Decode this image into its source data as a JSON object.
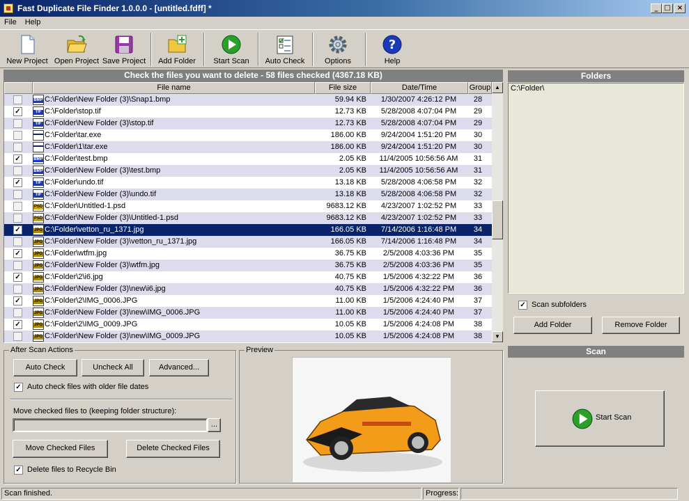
{
  "window": {
    "title": "Fast Duplicate File Finder 1.0.0.0 - [untitled.fdff] *",
    "buttons": {
      "minimize": "_",
      "maximize": "□",
      "close": "×"
    }
  },
  "menu": {
    "items": [
      "File",
      "Help"
    ]
  },
  "toolbar": {
    "new_project": "New Project",
    "open_project": "Open Project",
    "save_project": "Save Project",
    "add_folder": "Add Folder",
    "start_scan": "Start Scan",
    "auto_check": "Auto Check",
    "options": "Options",
    "help": "Help"
  },
  "files_panel": {
    "header": "Check the files you want to delete - 58 files checked (4367.18 KB)",
    "columns": {
      "name": "File name",
      "size": "File size",
      "date": "Date/Time",
      "group": "Group"
    }
  },
  "files": [
    {
      "checked": false,
      "type": "BMP",
      "name": "C:\\Folder\\New Folder (3)\\Snap1.bmp",
      "size": "59.94 KB",
      "date": "1/30/2007 4:26:12 PM",
      "group": "28"
    },
    {
      "checked": true,
      "type": "TIF",
      "name": "C:\\Folder\\stop.tif",
      "size": "12.73 KB",
      "date": "5/28/2008 4:07:04 PM",
      "group": "29"
    },
    {
      "checked": false,
      "type": "TIF",
      "name": "C:\\Folder\\New Folder (3)\\stop.tif",
      "size": "12.73 KB",
      "date": "5/28/2008 4:07:04 PM",
      "group": "29"
    },
    {
      "checked": false,
      "type": "EXE",
      "name": "C:\\Folder\\tar.exe",
      "size": "186.00 KB",
      "date": "9/24/2004 1:51:20 PM",
      "group": "30"
    },
    {
      "checked": false,
      "type": "EXE",
      "name": "C:\\Folder\\1\\tar.exe",
      "size": "186.00 KB",
      "date": "9/24/2004 1:51:20 PM",
      "group": "30"
    },
    {
      "checked": true,
      "type": "BMP",
      "name": "C:\\Folder\\test.bmp",
      "size": "2.05 KB",
      "date": "11/4/2005 10:56:56 AM",
      "group": "31"
    },
    {
      "checked": false,
      "type": "BMP",
      "name": "C:\\Folder\\New Folder (3)\\test.bmp",
      "size": "2.05 KB",
      "date": "11/4/2005 10:56:56 AM",
      "group": "31"
    },
    {
      "checked": true,
      "type": "TIF",
      "name": "C:\\Folder\\undo.tif",
      "size": "13.18 KB",
      "date": "5/28/2008 4:06:58 PM",
      "group": "32"
    },
    {
      "checked": false,
      "type": "TIF",
      "name": "C:\\Folder\\New Folder (3)\\undo.tif",
      "size": "13.18 KB",
      "date": "5/28/2008 4:06:58 PM",
      "group": "32"
    },
    {
      "checked": false,
      "type": "PSD",
      "name": "C:\\Folder\\Untitled-1.psd",
      "size": "9683.12 KB",
      "date": "4/23/2007 1:02:52 PM",
      "group": "33"
    },
    {
      "checked": false,
      "type": "PSD",
      "name": "C:\\Folder\\New Folder (3)\\Untitled-1.psd",
      "size": "9683.12 KB",
      "date": "4/23/2007 1:02:52 PM",
      "group": "33"
    },
    {
      "checked": true,
      "type": "JPG",
      "name": "C:\\Folder\\vetton_ru_1371.jpg",
      "size": "166.05 KB",
      "date": "7/14/2006 1:16:48 PM",
      "group": "34",
      "selected": true
    },
    {
      "checked": false,
      "type": "JPG",
      "name": "C:\\Folder\\New Folder (3)\\vetton_ru_1371.jpg",
      "size": "166.05 KB",
      "date": "7/14/2006 1:16:48 PM",
      "group": "34"
    },
    {
      "checked": true,
      "type": "JPG",
      "name": "C:\\Folder\\wtfm.jpg",
      "size": "36.75 KB",
      "date": "2/5/2008 4:03:36 PM",
      "group": "35"
    },
    {
      "checked": false,
      "type": "JPG",
      "name": "C:\\Folder\\New Folder (3)\\wtfm.jpg",
      "size": "36.75 KB",
      "date": "2/5/2008 4:03:36 PM",
      "group": "35"
    },
    {
      "checked": true,
      "type": "JPG",
      "name": "C:\\Folder\\2\\i6.jpg",
      "size": "40.75 KB",
      "date": "1/5/2006 4:32:22 PM",
      "group": "36"
    },
    {
      "checked": false,
      "type": "JPG",
      "name": "C:\\Folder\\New Folder (3)\\new\\i6.jpg",
      "size": "40.75 KB",
      "date": "1/5/2006 4:32:22 PM",
      "group": "36"
    },
    {
      "checked": true,
      "type": "JPG",
      "name": "C:\\Folder\\2\\IMG_0006.JPG",
      "size": "11.00 KB",
      "date": "1/5/2006 4:24:40 PM",
      "group": "37"
    },
    {
      "checked": false,
      "type": "JPG",
      "name": "C:\\Folder\\New Folder (3)\\new\\IMG_0006.JPG",
      "size": "11.00 KB",
      "date": "1/5/2006 4:24:40 PM",
      "group": "37"
    },
    {
      "checked": true,
      "type": "JPG",
      "name": "C:\\Folder\\2\\IMG_0009.JPG",
      "size": "10.05 KB",
      "date": "1/5/2006 4:24:08 PM",
      "group": "38"
    },
    {
      "checked": false,
      "type": "JPG",
      "name": "C:\\Folder\\New Folder (3)\\new\\IMG_0009.JPG",
      "size": "10.05 KB",
      "date": "1/5/2006 4:24:08 PM",
      "group": "38"
    }
  ],
  "folders_panel": {
    "header": "Folders",
    "items": [
      "C:\\Folder\\"
    ],
    "scan_subfolders": "Scan subfolders",
    "add_folder": "Add Folder",
    "remove_folder": "Remove Folder"
  },
  "after_scan": {
    "label": "After Scan Actions",
    "auto_check": "Auto Check",
    "uncheck_all": "Uncheck All",
    "advanced": "Advanced...",
    "auto_check_older": "Auto check files with older file dates",
    "move_label": "Move checked files to (keeping folder structure):",
    "move_path": "",
    "browse": "...",
    "move_button": "Move Checked Files",
    "delete_button": "Delete Checked Files",
    "recycle_bin": "Delete files to Recycle Bin"
  },
  "preview": {
    "label": "Preview"
  },
  "scan_panel": {
    "header": "Scan",
    "start_scan": "Start Scan"
  },
  "status": {
    "message": "Scan finished.",
    "progress_label": "Progress:"
  },
  "colors": {
    "title_start": "#0a246a",
    "selection": "#0a246a",
    "alt_row": "#dcdcec",
    "face": "#d4d0c8",
    "panel_header": "#808080"
  },
  "icons": [
    "new-project-icon",
    "open-folder-icon",
    "save-disk-icon",
    "add-folder-icon",
    "play-icon",
    "auto-check-icon",
    "gear-icon",
    "help-icon"
  ]
}
